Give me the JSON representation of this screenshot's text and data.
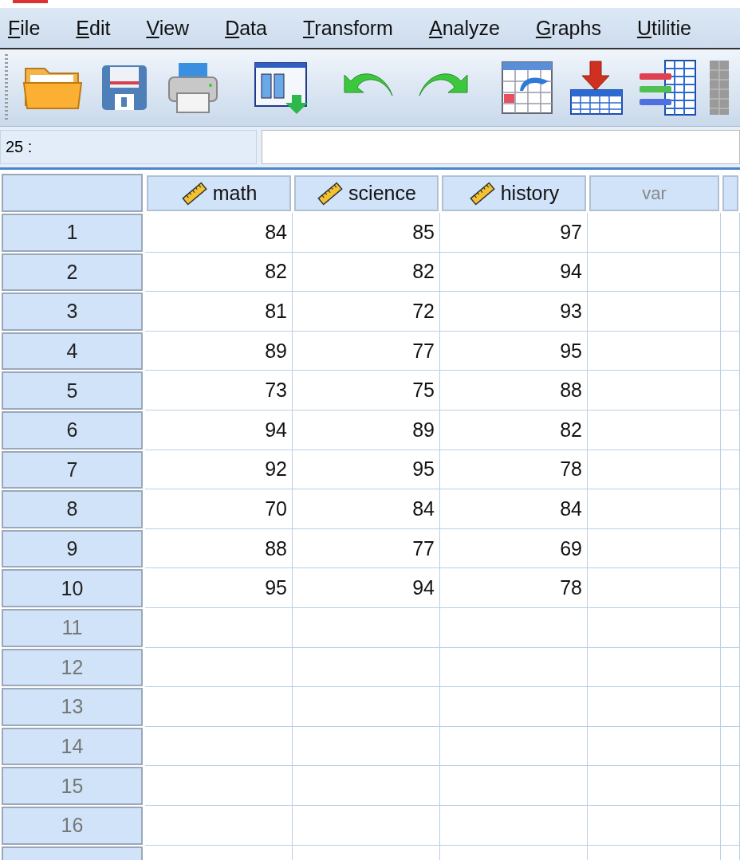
{
  "menu": [
    {
      "label": "File"
    },
    {
      "label": "Edit"
    },
    {
      "label": "View"
    },
    {
      "label": "Data"
    },
    {
      "label": "Transform"
    },
    {
      "label": "Analyze"
    },
    {
      "label": "Graphs"
    },
    {
      "label": "Utilitie"
    }
  ],
  "cell_reference": {
    "label": "25 :"
  },
  "columns": [
    {
      "name": "math",
      "kind": "scale"
    },
    {
      "name": "science",
      "kind": "scale"
    },
    {
      "name": "history",
      "kind": "scale"
    },
    {
      "name": "var",
      "kind": "placeholder"
    }
  ],
  "rows": [
    {
      "number": "1",
      "dimmed": false,
      "values": [
        "84",
        "85",
        "97"
      ]
    },
    {
      "number": "2",
      "dimmed": false,
      "values": [
        "82",
        "82",
        "94"
      ]
    },
    {
      "number": "3",
      "dimmed": false,
      "values": [
        "81",
        "72",
        "93"
      ]
    },
    {
      "number": "4",
      "dimmed": false,
      "values": [
        "89",
        "77",
        "95"
      ]
    },
    {
      "number": "5",
      "dimmed": false,
      "values": [
        "73",
        "75",
        "88"
      ]
    },
    {
      "number": "6",
      "dimmed": false,
      "values": [
        "94",
        "89",
        "82"
      ]
    },
    {
      "number": "7",
      "dimmed": false,
      "values": [
        "92",
        "95",
        "78"
      ]
    },
    {
      "number": "8",
      "dimmed": false,
      "values": [
        "70",
        "84",
        "84"
      ]
    },
    {
      "number": "9",
      "dimmed": false,
      "values": [
        "88",
        "77",
        "69"
      ]
    },
    {
      "number": "10",
      "dimmed": false,
      "values": [
        "95",
        "94",
        "78"
      ]
    },
    {
      "number": "11",
      "dimmed": true,
      "values": []
    },
    {
      "number": "12",
      "dimmed": true,
      "values": []
    },
    {
      "number": "13",
      "dimmed": true,
      "values": []
    },
    {
      "number": "14",
      "dimmed": true,
      "values": []
    },
    {
      "number": "15",
      "dimmed": true,
      "values": []
    },
    {
      "number": "16",
      "dimmed": true,
      "values": []
    },
    {
      "values": []
    }
  ]
}
